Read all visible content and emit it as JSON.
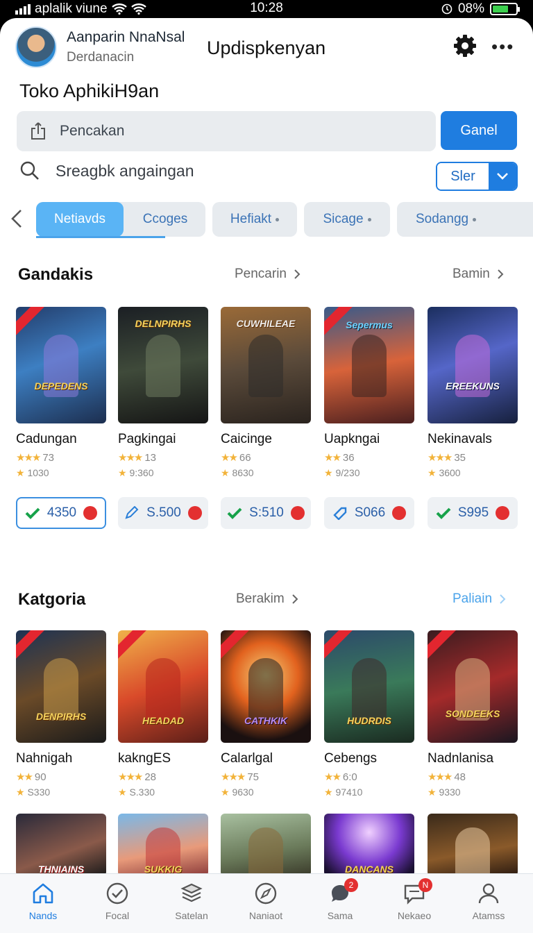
{
  "status_bar": {
    "carrier": "aplalik viune",
    "time": "10:28",
    "battery": "08%"
  },
  "header": {
    "user_name": "Aanparin NnaNsal",
    "user_sub": "Derdanacin",
    "center_title": "Updispkenyan",
    "gear_icon": "gear-icon",
    "more_icon": "more-icon"
  },
  "store_title": "Toko AphikiH9an",
  "search": {
    "placeholder": "Pencakan",
    "button_label": "Ganel"
  },
  "search2": {
    "placeholder": "Sreagbk angaingan",
    "filter_label": "Sler"
  },
  "tabs": [
    "Netiavds",
    "Ccoges",
    "Hefiakt",
    "Sicage",
    "Sodangg"
  ],
  "section1": {
    "title": "Gandakis",
    "link1": "Pencarin",
    "link2": "Bamin",
    "items": [
      {
        "title": "Cadungan",
        "rating": "73",
        "downloads": "1030",
        "logo": "DEPEDENS",
        "stars": 3
      },
      {
        "title": "Pagkingai",
        "rating": "13",
        "downloads": "9:360",
        "logo": "DELNPIRHS",
        "stars": 3
      },
      {
        "title": "Caicinge",
        "rating": "66",
        "downloads": "8630",
        "logo": "CUWHILEAE",
        "stars": 2
      },
      {
        "title": "Uapkngai",
        "rating": "36",
        "downloads": "9/230",
        "logo": "Sepermus",
        "stars": 2
      },
      {
        "title": "Nekinavals",
        "rating": "35",
        "downloads": "3600",
        "logo": "EREEKUNS",
        "stars": 3
      }
    ],
    "prices": [
      "4350",
      "S.500",
      "S:510",
      "S066",
      "S995"
    ]
  },
  "section2": {
    "title": "Katgoria",
    "link1": "Berakim",
    "link2": "Paliain",
    "items": [
      {
        "title": "Nahnigah",
        "rating": "90",
        "downloads": "S330",
        "logo": "DENPIRHS",
        "stars": 2
      },
      {
        "title": "kakngES",
        "rating": "28",
        "downloads": "S.330",
        "logo": "HEADAD",
        "stars": 3
      },
      {
        "title": "Calarlgal",
        "rating": "75",
        "downloads": "9630",
        "logo": "CATHKIK",
        "stars": 3
      },
      {
        "title": "Cebengs",
        "rating": "6:0",
        "downloads": "97410",
        "logo": "HUDRDIS",
        "stars": 2
      },
      {
        "title": "Nadnlanisa",
        "rating": "48",
        "downloads": "9330",
        "logo": "SONDEEKS",
        "stars": 3
      }
    ],
    "partial_logos": [
      "THNIAINS",
      "SUKKIG",
      "",
      "DANCANS",
      ""
    ]
  },
  "bottom_nav": [
    {
      "label": "Nands",
      "icon": "home-icon",
      "badge": ""
    },
    {
      "label": "Focal",
      "icon": "check-circle-icon",
      "badge": ""
    },
    {
      "label": "Satelan",
      "icon": "stack-icon",
      "badge": ""
    },
    {
      "label": "Naniaot",
      "icon": "compass-icon",
      "badge": ""
    },
    {
      "label": "Sama",
      "icon": "chat-icon",
      "badge": "2"
    },
    {
      "label": "Nekaeo",
      "icon": "inbox-icon",
      "badge": "N"
    },
    {
      "label": "Atamss",
      "icon": "person-icon",
      "badge": ""
    }
  ],
  "colors": {
    "accent": "#1f7de0",
    "tab_active": "#5ab4f5",
    "badge": "#e33030",
    "star": "#f2b33a"
  }
}
